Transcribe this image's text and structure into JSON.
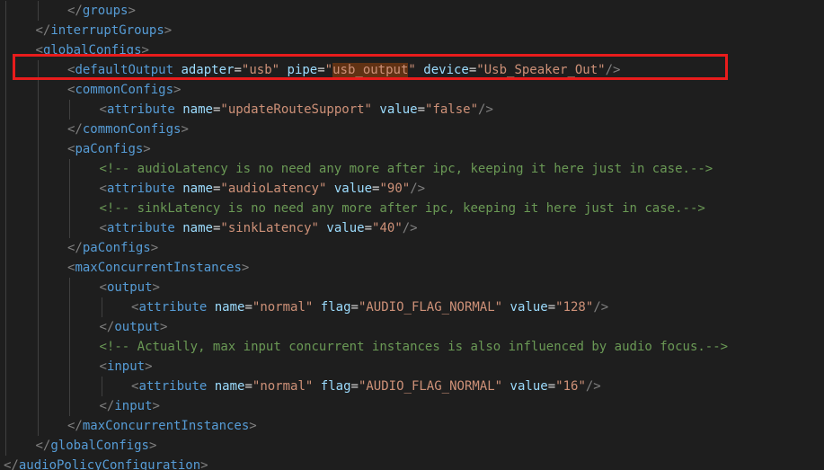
{
  "editor": {
    "language": "xml",
    "highlighted_line": 3,
    "selected_text": "usb_output"
  },
  "lines": [
    {
      "indent": 2,
      "kind": "close",
      "tag": "groups"
    },
    {
      "indent": 1,
      "kind": "close",
      "tag": "interruptGroups"
    },
    {
      "indent": 1,
      "kind": "open",
      "tag": "globalConfigs"
    },
    {
      "indent": 2,
      "kind": "self",
      "tag": "defaultOutput",
      "attrs": [
        {
          "name": "adapter",
          "value": "usb"
        },
        {
          "name": "pipe",
          "value": "usb_output"
        },
        {
          "name": "device",
          "value": "Usb_Speaker_Out"
        }
      ]
    },
    {
      "indent": 2,
      "kind": "open",
      "tag": "commonConfigs"
    },
    {
      "indent": 3,
      "kind": "self",
      "tag": "attribute",
      "attrs": [
        {
          "name": "name",
          "value": "updateRouteSupport"
        },
        {
          "name": "value",
          "value": "false"
        }
      ]
    },
    {
      "indent": 2,
      "kind": "close",
      "tag": "commonConfigs"
    },
    {
      "indent": 2,
      "kind": "open",
      "tag": "paConfigs"
    },
    {
      "indent": 3,
      "kind": "comment",
      "text": "<!-- audioLatency is no need any more after ipc, keeping it here just in case.-->"
    },
    {
      "indent": 3,
      "kind": "self",
      "tag": "attribute",
      "attrs": [
        {
          "name": "name",
          "value": "audioLatency"
        },
        {
          "name": "value",
          "value": "90"
        }
      ]
    },
    {
      "indent": 3,
      "kind": "comment",
      "text": "<!-- sinkLatency is no need any more after ipc, keeping it here just in case.-->"
    },
    {
      "indent": 3,
      "kind": "self",
      "tag": "attribute",
      "attrs": [
        {
          "name": "name",
          "value": "sinkLatency"
        },
        {
          "name": "value",
          "value": "40"
        }
      ]
    },
    {
      "indent": 2,
      "kind": "close",
      "tag": "paConfigs"
    },
    {
      "indent": 2,
      "kind": "open",
      "tag": "maxConcurrentInstances"
    },
    {
      "indent": 3,
      "kind": "open",
      "tag": "output"
    },
    {
      "indent": 4,
      "kind": "self",
      "tag": "attribute",
      "attrs": [
        {
          "name": "name",
          "value": "normal"
        },
        {
          "name": "flag",
          "value": "AUDIO_FLAG_NORMAL"
        },
        {
          "name": "value",
          "value": "128"
        }
      ]
    },
    {
      "indent": 3,
      "kind": "close",
      "tag": "output"
    },
    {
      "indent": 3,
      "kind": "comment",
      "text": "<!-- Actually, max input concurrent instances is also influenced by audio focus.-->"
    },
    {
      "indent": 3,
      "kind": "open",
      "tag": "input"
    },
    {
      "indent": 4,
      "kind": "self",
      "tag": "attribute",
      "attrs": [
        {
          "name": "name",
          "value": "normal"
        },
        {
          "name": "flag",
          "value": "AUDIO_FLAG_NORMAL"
        },
        {
          "name": "value",
          "value": "16"
        }
      ]
    },
    {
      "indent": 3,
      "kind": "close",
      "tag": "input"
    },
    {
      "indent": 2,
      "kind": "close",
      "tag": "maxConcurrentInstances"
    },
    {
      "indent": 1,
      "kind": "close",
      "tag": "globalConfigs"
    },
    {
      "indent": 0,
      "kind": "close",
      "tag": "audioPolicyConfiguration"
    }
  ]
}
